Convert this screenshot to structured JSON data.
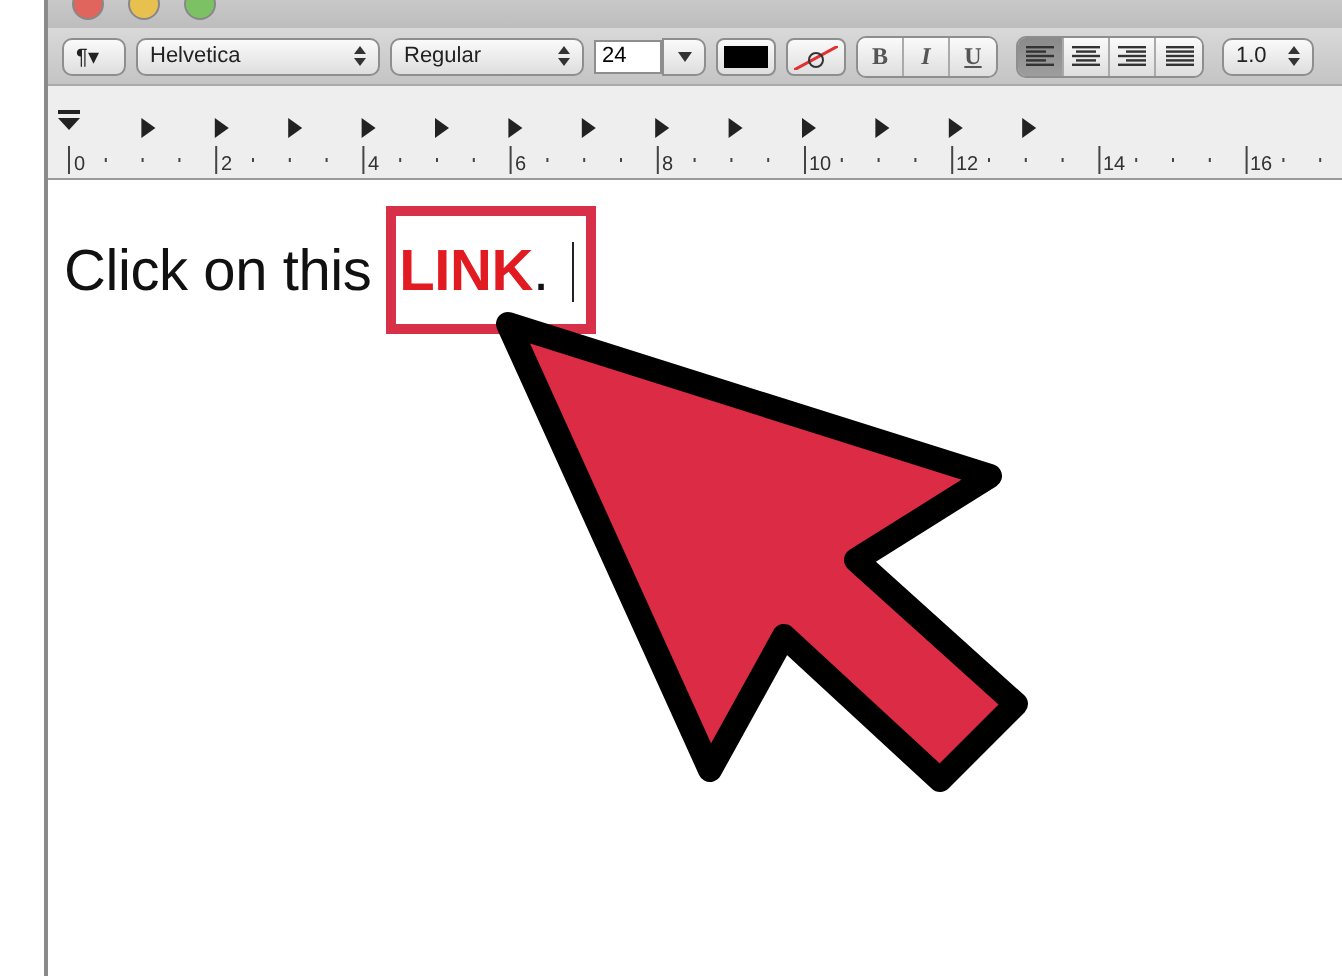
{
  "toolbar": {
    "paragraph_button": "¶▾",
    "font_family": "Helvetica",
    "font_style": "Regular",
    "font_size": "24",
    "style_buttons": [
      {
        "label": "B",
        "kind": "bold"
      },
      {
        "label": "I",
        "kind": "italic"
      },
      {
        "label": "U",
        "kind": "underline"
      }
    ],
    "alignment": [
      {
        "kind": "left",
        "selected": true
      },
      {
        "kind": "center",
        "selected": false
      },
      {
        "kind": "right",
        "selected": false
      },
      {
        "kind": "justify",
        "selected": false
      }
    ],
    "line_spacing": "1.0"
  },
  "ruler": {
    "labels": [
      "0",
      "2",
      "4",
      "6",
      "8",
      "10",
      "12",
      "14",
      "16"
    ]
  },
  "document": {
    "text": "Click on this **LINK**."
  }
}
